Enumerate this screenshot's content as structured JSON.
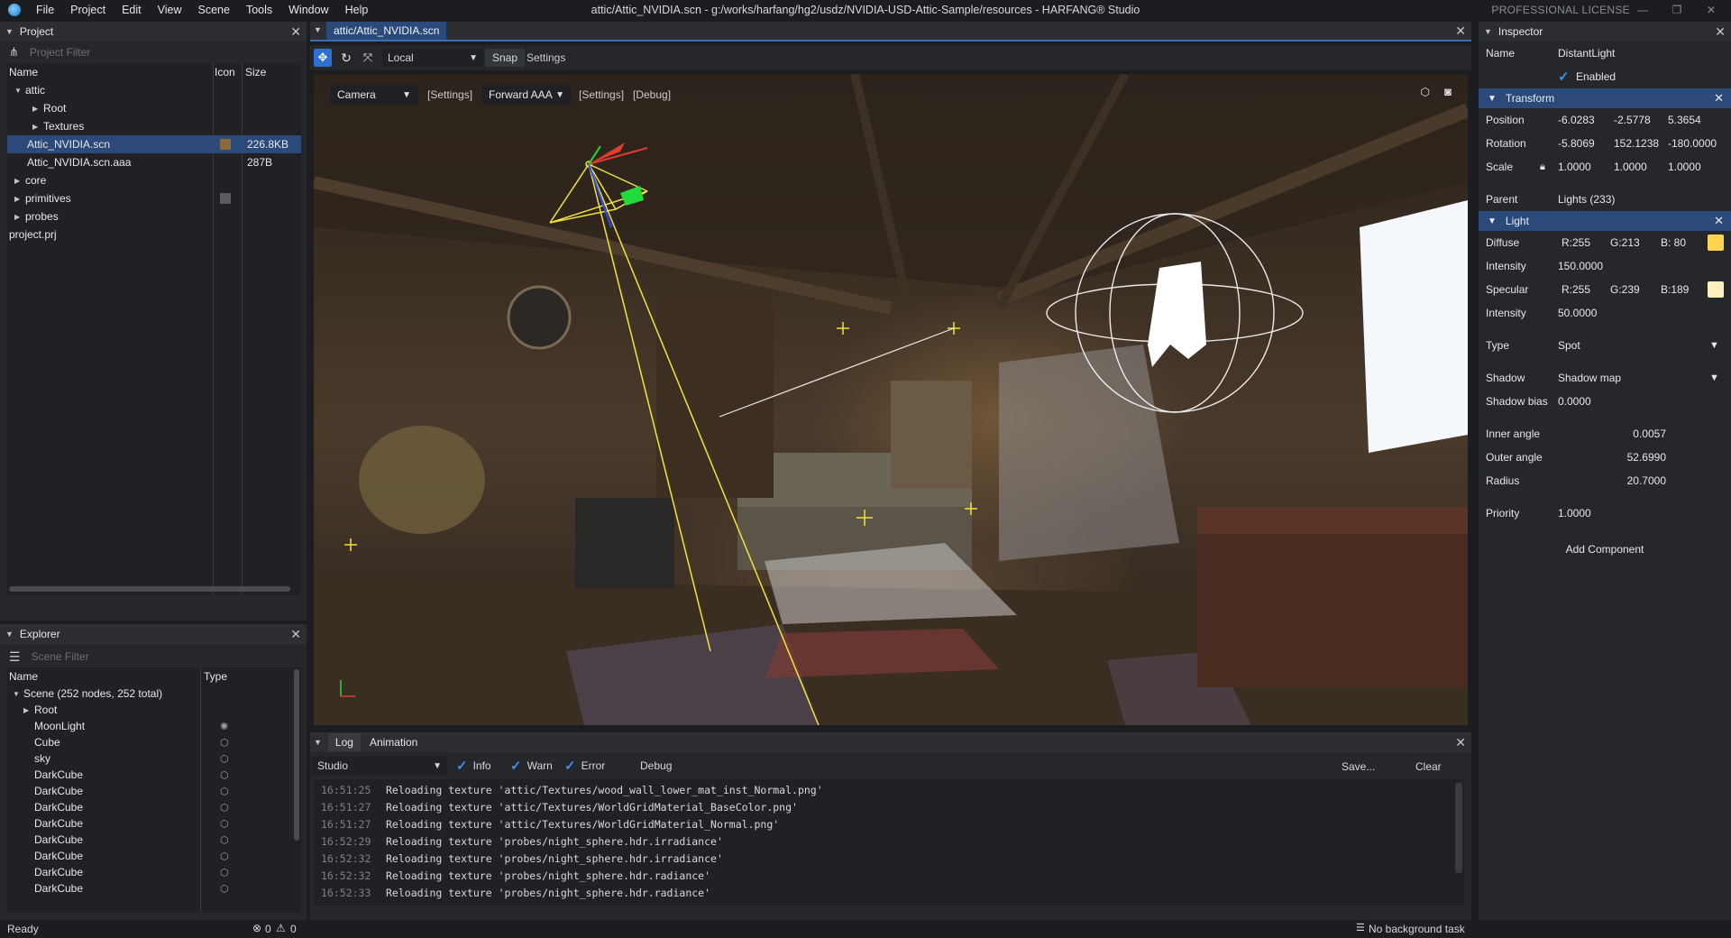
{
  "titlebar": {
    "menu": [
      "File",
      "Project",
      "Edit",
      "View",
      "Scene",
      "Tools",
      "Window",
      "Help"
    ],
    "title": "attic/Attic_NVIDIA.scn - g:/works/harfang/hg2/usdz/NVIDIA-USD-Attic-Sample/resources - HARFANG® Studio",
    "license": "PROFESSIONAL LICENSE"
  },
  "project": {
    "header": "Project",
    "filter_placeholder": "Project Filter",
    "columns": {
      "name": "Name",
      "icon": "Icon",
      "size": "Size"
    },
    "rows": [
      {
        "label": "attic",
        "arrow": "▼",
        "indent": 0,
        "size": ""
      },
      {
        "label": "Root",
        "arrow": "▶",
        "indent": 1,
        "size": ""
      },
      {
        "label": "Textures",
        "arrow": "▶",
        "indent": 1,
        "size": ""
      },
      {
        "label": "Attic_NVIDIA.scn",
        "arrow": "",
        "indent": 1,
        "size": "226.8KB",
        "selected": true
      },
      {
        "label": "Attic_NVIDIA.scn.aaa",
        "arrow": "",
        "indent": 1,
        "size": "287B"
      },
      {
        "label": "core",
        "arrow": "▶",
        "indent": 0,
        "size": ""
      },
      {
        "label": "primitives",
        "arrow": "▶",
        "indent": 0,
        "size": ""
      },
      {
        "label": "probes",
        "arrow": "▶",
        "indent": 0,
        "size": ""
      },
      {
        "label": "project.prj",
        "arrow": "",
        "indent": -1,
        "size": ""
      }
    ]
  },
  "explorer": {
    "header": "Explorer",
    "filter_placeholder": "Scene Filter",
    "columns": {
      "name": "Name",
      "type": "Type"
    },
    "scene_label": "Scene (252 nodes, 252 total)",
    "rows": [
      {
        "label": "Root",
        "arrow": "▶",
        "icon": ""
      },
      {
        "label": "MoonLight",
        "arrow": "",
        "icon": "light-icon"
      },
      {
        "label": "Cube",
        "arrow": "",
        "icon": "object-icon"
      },
      {
        "label": "sky",
        "arrow": "",
        "icon": "object-icon"
      },
      {
        "label": "DarkCube",
        "arrow": "",
        "icon": "object-icon"
      },
      {
        "label": "DarkCube",
        "arrow": "",
        "icon": "object-icon"
      },
      {
        "label": "DarkCube",
        "arrow": "",
        "icon": "object-icon"
      },
      {
        "label": "DarkCube",
        "arrow": "",
        "icon": "object-icon"
      },
      {
        "label": "DarkCube",
        "arrow": "",
        "icon": "object-icon"
      },
      {
        "label": "DarkCube",
        "arrow": "",
        "icon": "object-icon"
      },
      {
        "label": "DarkCube",
        "arrow": "",
        "icon": "object-icon"
      },
      {
        "label": "DarkCube",
        "arrow": "",
        "icon": "object-icon"
      }
    ]
  },
  "viewport": {
    "tab": "attic/Attic_NVIDIA.scn",
    "space": "Local",
    "snap": "Snap",
    "settings": "Settings",
    "camera": "Camera",
    "camera_settings": "[Settings]",
    "render": "Forward AAA",
    "render_settings": "[Settings]",
    "debug": "[Debug]"
  },
  "log": {
    "tabs": [
      "Log",
      "Animation"
    ],
    "source": "Studio",
    "filters": [
      "Info",
      "Warn",
      "Error"
    ],
    "debug": "Debug",
    "save": "Save...",
    "clear": "Clear",
    "lines": [
      {
        "time": "16:51:25",
        "msg": "Reloading texture 'attic/Textures/wood_wall_lower_mat_inst_Normal.png'"
      },
      {
        "time": "16:51:27",
        "msg": "Reloading texture 'attic/Textures/WorldGridMaterial_BaseColor.png'"
      },
      {
        "time": "16:51:27",
        "msg": "Reloading texture 'attic/Textures/WorldGridMaterial_Normal.png'"
      },
      {
        "time": "16:52:29",
        "msg": "Reloading texture 'probes/night_sphere.hdr.irradiance'"
      },
      {
        "time": "16:52:32",
        "msg": "Reloading texture 'probes/night_sphere.hdr.irradiance'"
      },
      {
        "time": "16:52:32",
        "msg": "Reloading texture 'probes/night_sphere.hdr.radiance'"
      },
      {
        "time": "16:52:33",
        "msg": "Reloading texture 'probes/night_sphere.hdr.radiance'"
      }
    ]
  },
  "inspector": {
    "header": "Inspector",
    "name_label": "Name",
    "name": "DistantLight",
    "enabled": "Enabled",
    "transform": {
      "title": "Transform",
      "position_label": "Position",
      "position": [
        "-6.0283",
        "-2.5778",
        "5.3654"
      ],
      "rotation_label": "Rotation",
      "rotation": [
        "-5.8069",
        "152.1238",
        "-180.0000"
      ],
      "scale_label": "Scale",
      "scale": [
        "1.0000",
        "1.0000",
        "1.0000"
      ]
    },
    "parent_label": "Parent",
    "parent": "Lights (233)",
    "light": {
      "title": "Light",
      "diffuse_label": "Diffuse",
      "diffuse": [
        "R:255",
        "G:213",
        "B: 80"
      ],
      "diffuse_color": "#ffd550",
      "intensity_label": "Intensity",
      "diffuse_intensity": "150.0000",
      "specular_label": "Specular",
      "specular": [
        "R:255",
        "G:239",
        "B:189"
      ],
      "specular_color": "#ffefbd",
      "specular_intensity": "50.0000",
      "type_label": "Type",
      "type": "Spot",
      "shadow_label": "Shadow",
      "shadow": "Shadow map",
      "shadow_bias_label": "Shadow bias",
      "shadow_bias": "0.0000",
      "inner_angle_label": "Inner angle",
      "inner_angle": "0.0057",
      "outer_angle_label": "Outer angle",
      "outer_angle": "52.6990",
      "radius_label": "Radius",
      "radius": "20.7000",
      "priority_label": "Priority",
      "priority": "1.0000"
    },
    "add_component": "Add Component"
  },
  "status": {
    "ready": "Ready",
    "errors": "0",
    "warnings": "0",
    "background": "No background task"
  }
}
